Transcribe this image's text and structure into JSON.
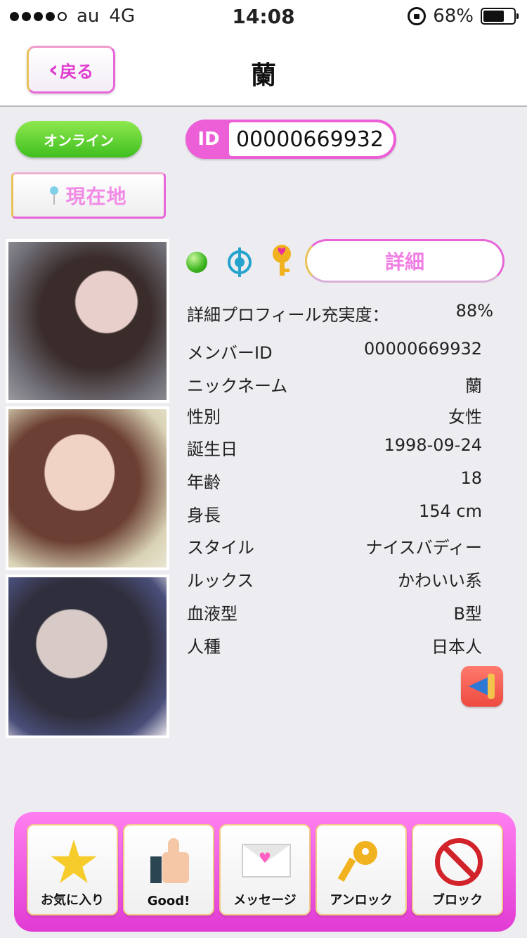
{
  "status_bar": {
    "carrier": "au",
    "network": "4G",
    "time": "14:08",
    "battery": "68%",
    "battery_level": 0.68,
    "signal_bars": 4
  },
  "nav": {
    "back_label": "戻る",
    "title": "蘭"
  },
  "online_label": "オンライン",
  "id_tag": "ID",
  "id_value": "00000669932",
  "location_label": "現在地",
  "detail_label": "詳細",
  "profile": {
    "completion_label": "詳細プロフィール充実度：",
    "completion_value": "88%",
    "rows": [
      {
        "label": "メンバーID",
        "value": "00000669932"
      },
      {
        "label": "ニックネーム",
        "value": "蘭"
      },
      {
        "label": "性別",
        "value": "女性"
      },
      {
        "label": "誕生日",
        "value": "1998-09-24"
      },
      {
        "label": "年齢",
        "value": "18"
      },
      {
        "label": "身長",
        "value": "154 cm"
      },
      {
        "label": "スタイル",
        "value": "ナイスバディー"
      },
      {
        "label": "ルックス",
        "value": "かわいい系"
      },
      {
        "label": "血液型",
        "value": "B型"
      },
      {
        "label": "人種",
        "value": "日本人"
      }
    ]
  },
  "toolbar": [
    {
      "label": "お気に入り",
      "icon": "star-icon"
    },
    {
      "label": "Good!",
      "icon": "thumbs-up-icon"
    },
    {
      "label": "メッセージ",
      "icon": "envelope-icon"
    },
    {
      "label": "アンロック",
      "icon": "key-icon"
    },
    {
      "label": "ブロック",
      "icon": "no-entry-icon"
    }
  ],
  "colors": {
    "accent_pink": "#e13bd4",
    "online_green": "#3fbf1f",
    "target_blue": "#26a3cc",
    "key_gold": "#f1b21f",
    "block_red": "#d2232a"
  }
}
